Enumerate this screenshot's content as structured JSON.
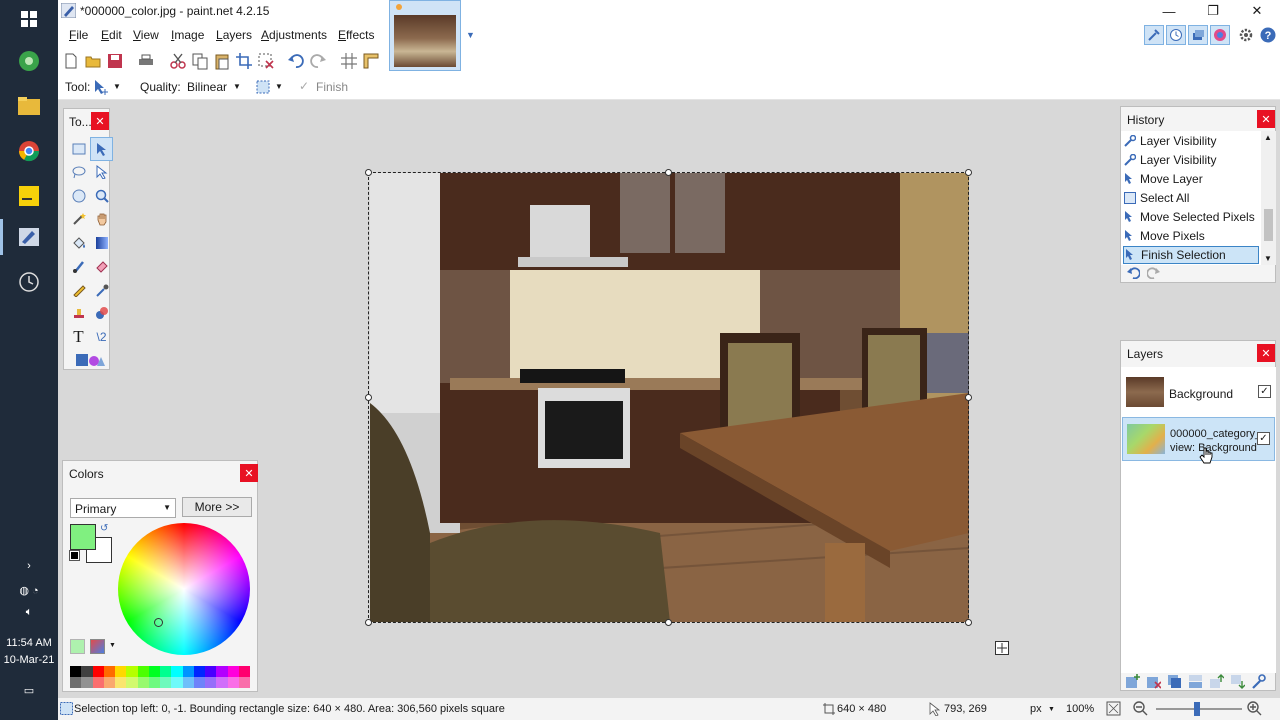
{
  "window": {
    "title": "*000000_color.jpg - paint.net 4.2.15"
  },
  "menu": [
    {
      "label": "File",
      "accel": "F",
      "rest": "ile"
    },
    {
      "label": "Edit",
      "accel": "E",
      "rest": "dit"
    },
    {
      "label": "View",
      "accel": "V",
      "rest": "iew"
    },
    {
      "label": "Image",
      "accel": "I",
      "rest": "mage"
    },
    {
      "label": "Layers",
      "accel": "L",
      "rest": "ayers"
    },
    {
      "label": "Adjustments",
      "accel": "A",
      "rest": "djustments"
    },
    {
      "label": "Effects",
      "accel": "E",
      "rest": "ffects"
    }
  ],
  "toolbar_options": {
    "tool_label": "Tool:",
    "quality_label": "Quality:",
    "quality_value": "Bilinear",
    "finish_label": "Finish"
  },
  "tools_panel": {
    "title": "To..."
  },
  "colors_panel": {
    "title": "Colors",
    "mode": "Primary",
    "more_button": "More >>",
    "primary_color": "#80f080",
    "secondary_color": "#ffffff"
  },
  "history_panel": {
    "title": "History",
    "items": [
      {
        "label": "Layer Visibility",
        "icon": "wrench-icon"
      },
      {
        "label": "Layer Visibility",
        "icon": "wrench-icon"
      },
      {
        "label": "Move Layer",
        "icon": "move-icon"
      },
      {
        "label": "Select All",
        "icon": "select-all-icon"
      },
      {
        "label": "Move Selected Pixels",
        "icon": "move-icon"
      },
      {
        "label": "Move Pixels",
        "icon": "move-icon"
      },
      {
        "label": "Finish Selection",
        "icon": "move-icon",
        "selected": true
      }
    ]
  },
  "layers_panel": {
    "title": "Layers",
    "layers": [
      {
        "name_line1": "Background",
        "name_line2": "",
        "visible": true
      },
      {
        "name_line1": "000000_category_",
        "name_line2": "view: Background",
        "visible": true,
        "selected": true
      }
    ]
  },
  "statusbar": {
    "selection_info": "Selection top left: 0, -1. Bounding rectangle size: 640 × 480. Area: 306,560 pixels square",
    "image_size": "640 × 480",
    "cursor_pos": "793, 269",
    "units": "px",
    "zoom": "100%"
  },
  "taskbar": {
    "time": "11:54 AM",
    "date": "10-Mar-21"
  },
  "palette_colors": [
    "#000000",
    "#404040",
    "#ff0000",
    "#ff6a00",
    "#ffd800",
    "#b6ff00",
    "#4cff00",
    "#00ff21",
    "#00ff90",
    "#00ffff",
    "#0094ff",
    "#0026ff",
    "#4800ff",
    "#b200ff",
    "#ff00dc",
    "#ff006e"
  ]
}
